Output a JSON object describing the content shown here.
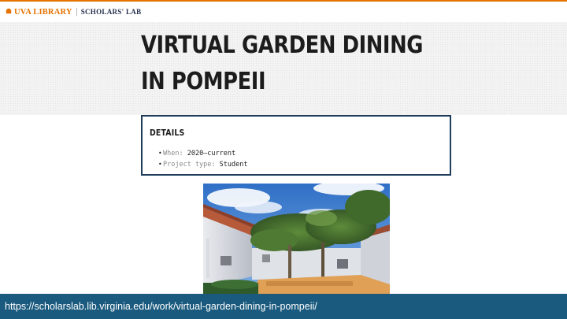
{
  "header": {
    "library_name": "UVA LIBRARY",
    "lab_name": "SCHOLARS' LAB",
    "accent_color": "#e57200",
    "navy_color": "#232d4b",
    "logo_icon": "rotunda-icon"
  },
  "page": {
    "title": "VIRTUAL GARDEN DINING IN POMPEII"
  },
  "details": {
    "heading": "DETAILS",
    "items": [
      {
        "key": "When:",
        "value": "2020–current"
      },
      {
        "key": "Project type:",
        "value": "Student"
      }
    ],
    "border_color": "#1e3d5a"
  },
  "image": {
    "subject": "virtual-garden-scene"
  },
  "footer": {
    "url": "https://scholarslab.lib.virginia.edu/work/virtual-garden-dining-in-pompeii/",
    "bar_color": "#1a5a7e"
  }
}
